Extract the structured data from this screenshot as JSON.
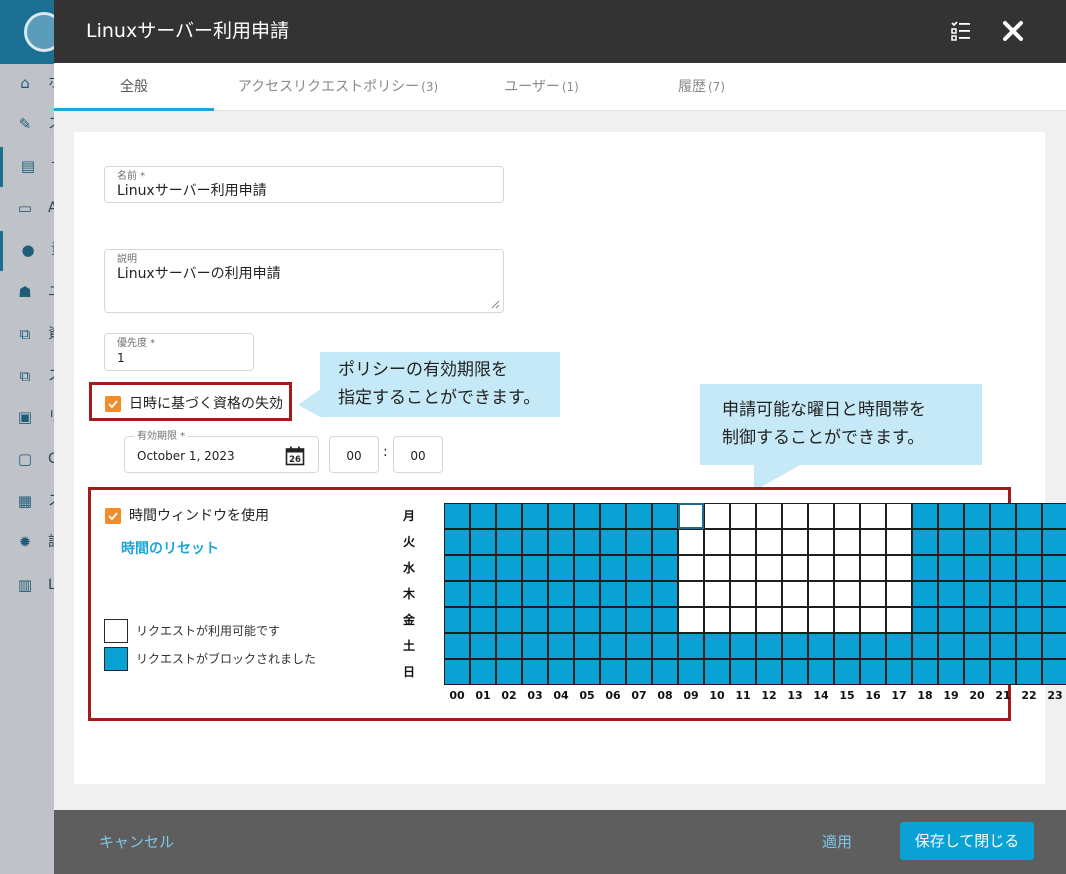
{
  "sidebar": {
    "items": [
      {
        "icon": "home-icon",
        "glyph": "⌂",
        "label": "ホ",
        "active": false
      },
      {
        "icon": "wrench-icon",
        "glyph": "✎",
        "label": "ス",
        "active": false
      },
      {
        "icon": "database-icon",
        "glyph": "▤",
        "label": "サ",
        "active": true
      },
      {
        "icon": "chat-icon",
        "glyph": "▭",
        "label": "A",
        "active": false
      },
      {
        "icon": "user-icon",
        "glyph": "●",
        "label": "資",
        "active": true
      },
      {
        "icon": "users-icon",
        "glyph": "☗",
        "label": "ユ",
        "active": false
      },
      {
        "icon": "copy-icon",
        "glyph": "⧉",
        "label": "資",
        "active": false
      },
      {
        "icon": "layers-icon",
        "glyph": "⧉",
        "label": "ス",
        "active": false
      },
      {
        "icon": "monitor-icon",
        "glyph": "▣",
        "label": "リ",
        "active": false
      },
      {
        "icon": "messages-icon",
        "glyph": "▢",
        "label": "C",
        "active": false
      },
      {
        "icon": "network-icon",
        "glyph": "▦",
        "label": "ス",
        "active": false
      },
      {
        "icon": "cog-icon",
        "glyph": "✹",
        "label": "設",
        "active": false
      },
      {
        "icon": "book-icon",
        "glyph": "▥",
        "label": "L",
        "active": false
      }
    ]
  },
  "modal": {
    "title": "Linuxサーバー利用申請",
    "tabs": [
      {
        "label": "全般",
        "count": "",
        "active": true
      },
      {
        "label": "アクセスリクエストポリシー",
        "count": "(3)",
        "active": false
      },
      {
        "label": "ユーザー",
        "count": "(1)",
        "active": false
      },
      {
        "label": "履歴",
        "count": "(7)",
        "active": false
      }
    ]
  },
  "form": {
    "name": {
      "label": "名前 *",
      "value": "Linuxサーバー利用申請"
    },
    "description": {
      "label": "説明",
      "value": "Linuxサーバーの利用申請"
    },
    "priority": {
      "label": "優先度 *",
      "value": "1"
    },
    "expire_checkbox": {
      "label": "日時に基づく資格の失効",
      "checked": true
    },
    "expiry": {
      "label": "有効期限 *",
      "date": "October 1, 2023",
      "calendar_day": "26",
      "hour": "00",
      "separator": ":",
      "minute": "00"
    },
    "time_window": {
      "checkbox_label": "時間ウィンドウを使用",
      "checked": true,
      "reset_label": "時間のリセット"
    }
  },
  "legend": {
    "available": "リクエストが利用可能です",
    "blocked": "リクエストがブロックされました"
  },
  "schedule": {
    "days": [
      "月",
      "火",
      "水",
      "木",
      "金",
      "土",
      "日"
    ],
    "hours": [
      "00",
      "01",
      "02",
      "03",
      "04",
      "05",
      "06",
      "07",
      "08",
      "09",
      "10",
      "11",
      "12",
      "13",
      "14",
      "15",
      "16",
      "17",
      "18",
      "19",
      "20",
      "21",
      "22",
      "23"
    ],
    "available_days": [
      0,
      1,
      2,
      3,
      4
    ],
    "available_hours": [
      9,
      10,
      11,
      12,
      13,
      14,
      15,
      16,
      17
    ],
    "focused_cell": {
      "day": 0,
      "hour": 9
    },
    "colors": {
      "blocked": "#0aa2d4",
      "available": "#ffffff"
    }
  },
  "callouts": {
    "expiry": [
      "ポリシーの有効期限を",
      "指定することができます。"
    ],
    "schedule": [
      "申請可能な曜日と時間帯を",
      "制御することができます。"
    ]
  },
  "footer": {
    "cancel": "キャンセル",
    "apply": "適用",
    "save": "保存して閉じる"
  },
  "colors": {
    "accent": "#1aa6d8",
    "highlight_border": "#a31b1b",
    "checkbox": "#f08c2a",
    "callout_bg": "#c5e9f6"
  }
}
